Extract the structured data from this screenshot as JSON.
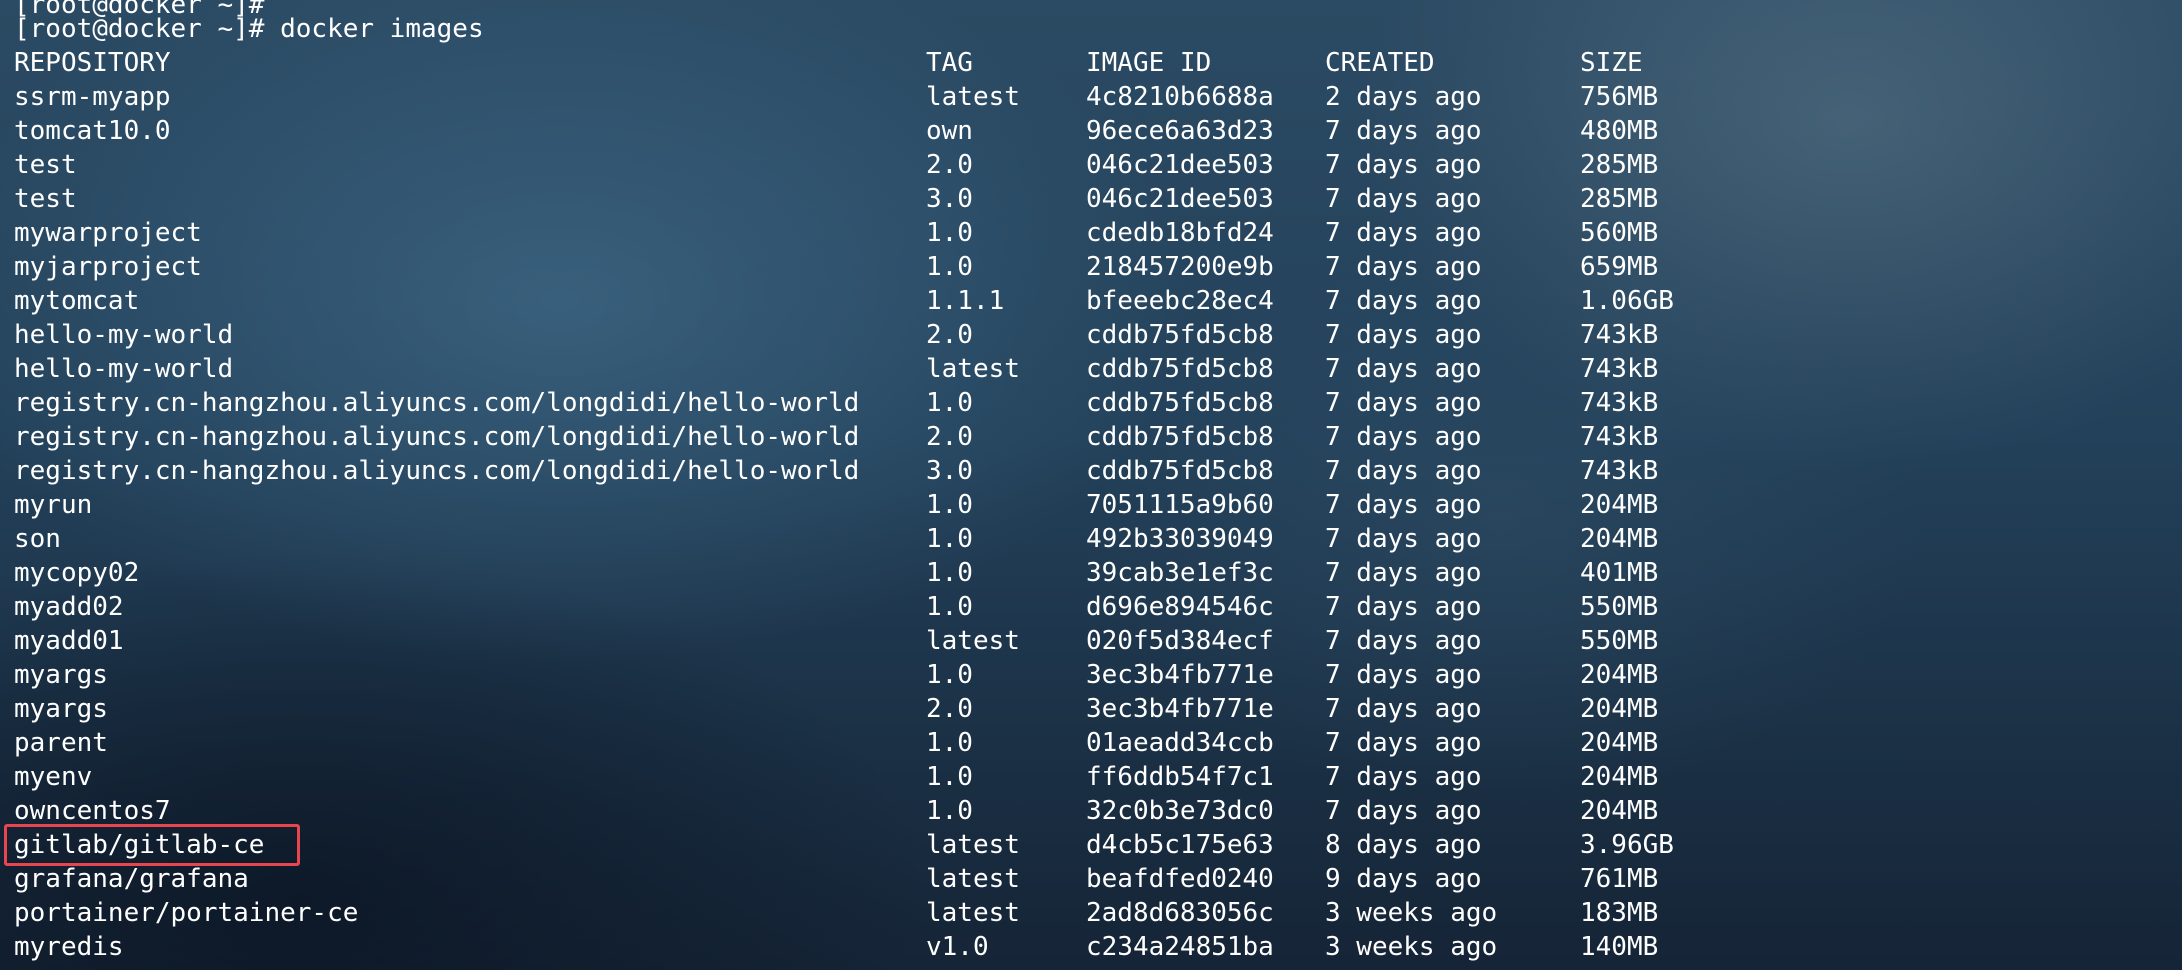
{
  "terminal": {
    "partial_top_line": "[root@docker ~]#",
    "prompt": "[root@docker ~]#",
    "command": "docker images",
    "highlight_color": "#e8454f"
  },
  "table": {
    "headers": {
      "repository": "REPOSITORY",
      "tag": "TAG",
      "image_id": "IMAGE ID",
      "created": "CREATED",
      "size": "SIZE"
    },
    "rows": [
      {
        "repository": "ssrm-myapp",
        "tag": "latest",
        "image_id": "4c8210b6688a",
        "created": "2 days ago",
        "size": "756MB"
      },
      {
        "repository": "tomcat10.0",
        "tag": "own",
        "image_id": "96ece6a63d23",
        "created": "7 days ago",
        "size": "480MB"
      },
      {
        "repository": "test",
        "tag": "2.0",
        "image_id": "046c21dee503",
        "created": "7 days ago",
        "size": "285MB"
      },
      {
        "repository": "test",
        "tag": "3.0",
        "image_id": "046c21dee503",
        "created": "7 days ago",
        "size": "285MB"
      },
      {
        "repository": "mywarproject",
        "tag": "1.0",
        "image_id": "cdedb18bfd24",
        "created": "7 days ago",
        "size": "560MB"
      },
      {
        "repository": "myjarproject",
        "tag": "1.0",
        "image_id": "218457200e9b",
        "created": "7 days ago",
        "size": "659MB"
      },
      {
        "repository": "mytomcat",
        "tag": "1.1.1",
        "image_id": "bfeeebc28ec4",
        "created": "7 days ago",
        "size": "1.06GB"
      },
      {
        "repository": "hello-my-world",
        "tag": "2.0",
        "image_id": "cddb75fd5cb8",
        "created": "7 days ago",
        "size": "743kB"
      },
      {
        "repository": "hello-my-world",
        "tag": "latest",
        "image_id": "cddb75fd5cb8",
        "created": "7 days ago",
        "size": "743kB"
      },
      {
        "repository": "registry.cn-hangzhou.aliyuncs.com/longdidi/hello-world",
        "tag": "1.0",
        "image_id": "cddb75fd5cb8",
        "created": "7 days ago",
        "size": "743kB"
      },
      {
        "repository": "registry.cn-hangzhou.aliyuncs.com/longdidi/hello-world",
        "tag": "2.0",
        "image_id": "cddb75fd5cb8",
        "created": "7 days ago",
        "size": "743kB"
      },
      {
        "repository": "registry.cn-hangzhou.aliyuncs.com/longdidi/hello-world",
        "tag": "3.0",
        "image_id": "cddb75fd5cb8",
        "created": "7 days ago",
        "size": "743kB"
      },
      {
        "repository": "myrun",
        "tag": "1.0",
        "image_id": "7051115a9b60",
        "created": "7 days ago",
        "size": "204MB"
      },
      {
        "repository": "son",
        "tag": "1.0",
        "image_id": "492b33039049",
        "created": "7 days ago",
        "size": "204MB"
      },
      {
        "repository": "mycopy02",
        "tag": "1.0",
        "image_id": "39cab3e1ef3c",
        "created": "7 days ago",
        "size": "401MB"
      },
      {
        "repository": "myadd02",
        "tag": "1.0",
        "image_id": "d696e894546c",
        "created": "7 days ago",
        "size": "550MB"
      },
      {
        "repository": "myadd01",
        "tag": "latest",
        "image_id": "020f5d384ecf",
        "created": "7 days ago",
        "size": "550MB"
      },
      {
        "repository": "myargs",
        "tag": "1.0",
        "image_id": "3ec3b4fb771e",
        "created": "7 days ago",
        "size": "204MB"
      },
      {
        "repository": "myargs",
        "tag": "2.0",
        "image_id": "3ec3b4fb771e",
        "created": "7 days ago",
        "size": "204MB"
      },
      {
        "repository": "parent",
        "tag": "1.0",
        "image_id": "01aeadd34ccb",
        "created": "7 days ago",
        "size": "204MB"
      },
      {
        "repository": "myenv",
        "tag": "1.0",
        "image_id": "ff6ddb54f7c1",
        "created": "7 days ago",
        "size": "204MB"
      },
      {
        "repository": "owncentos7",
        "tag": "1.0",
        "image_id": "32c0b3e73dc0",
        "created": "7 days ago",
        "size": "204MB"
      },
      {
        "repository": "gitlab/gitlab-ce",
        "tag": "latest",
        "image_id": "d4cb5c175e63",
        "created": "8 days ago",
        "size": "3.96GB"
      },
      {
        "repository": "grafana/grafana",
        "tag": "latest",
        "image_id": "beafdfed0240",
        "created": "9 days ago",
        "size": "761MB"
      },
      {
        "repository": "portainer/portainer-ce",
        "tag": "latest",
        "image_id": "2ad8d683056c",
        "created": "3 weeks ago",
        "size": "183MB"
      },
      {
        "repository": "myredis",
        "tag": "v1.0",
        "image_id": "c234a24851ba",
        "created": "3 weeks ago",
        "size": "140MB"
      }
    ]
  }
}
